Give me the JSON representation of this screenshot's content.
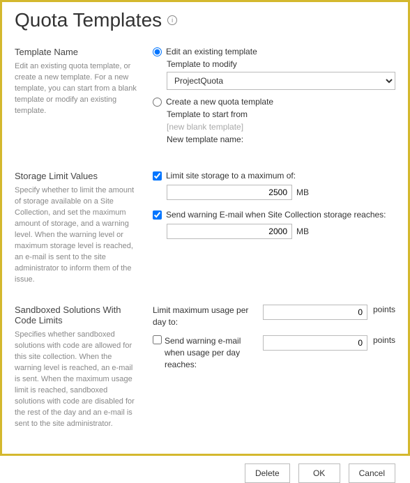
{
  "title": "Quota Templates",
  "templateName": {
    "heading": "Template Name",
    "desc": "Edit an existing quota template, or create a new template. For a new template, you can start from a blank template or modify an existing template.",
    "editLabel": "Edit an existing template",
    "modifyLabel": "Template to modify",
    "modifyValue": "ProjectQuota",
    "createLabel": "Create a new quota template",
    "startFromLabel": "Template to start from",
    "startFromPlaceholder": "[new blank template]",
    "newNameLabel": "New template name:"
  },
  "storageLimit": {
    "heading": "Storage Limit Values",
    "desc": "Specify whether to limit the amount of storage available on a Site Collection, and set the maximum amount of storage, and a warning level. When the warning level or maximum storage level is reached, an e-mail is sent to the site administrator to inform them of the issue.",
    "limitLabel": "Limit site storage to a maximum of:",
    "limitValue": "2500",
    "limitUnit": "MB",
    "warnLabel": "Send warning E-mail when Site Collection storage reaches:",
    "warnValue": "2000",
    "warnUnit": "MB"
  },
  "sandbox": {
    "heading": "Sandboxed Solutions With Code Limits",
    "desc": "Specifies whether sandboxed solutions with code are allowed for this site collection. When the warning level is reached, an e-mail is sent. When the maximum usage limit is reached, sandboxed solutions with code are disabled for the rest of the day and an e-mail is sent to the site administrator.",
    "maxLabel": "Limit maximum usage per day to:",
    "maxValue": "0",
    "maxUnit": "points",
    "warnLabel": "Send warning e-mail when usage per day reaches:",
    "warnValue": "0",
    "warnUnit": "points"
  },
  "buttons": {
    "delete": "Delete",
    "ok": "OK",
    "cancel": "Cancel"
  }
}
